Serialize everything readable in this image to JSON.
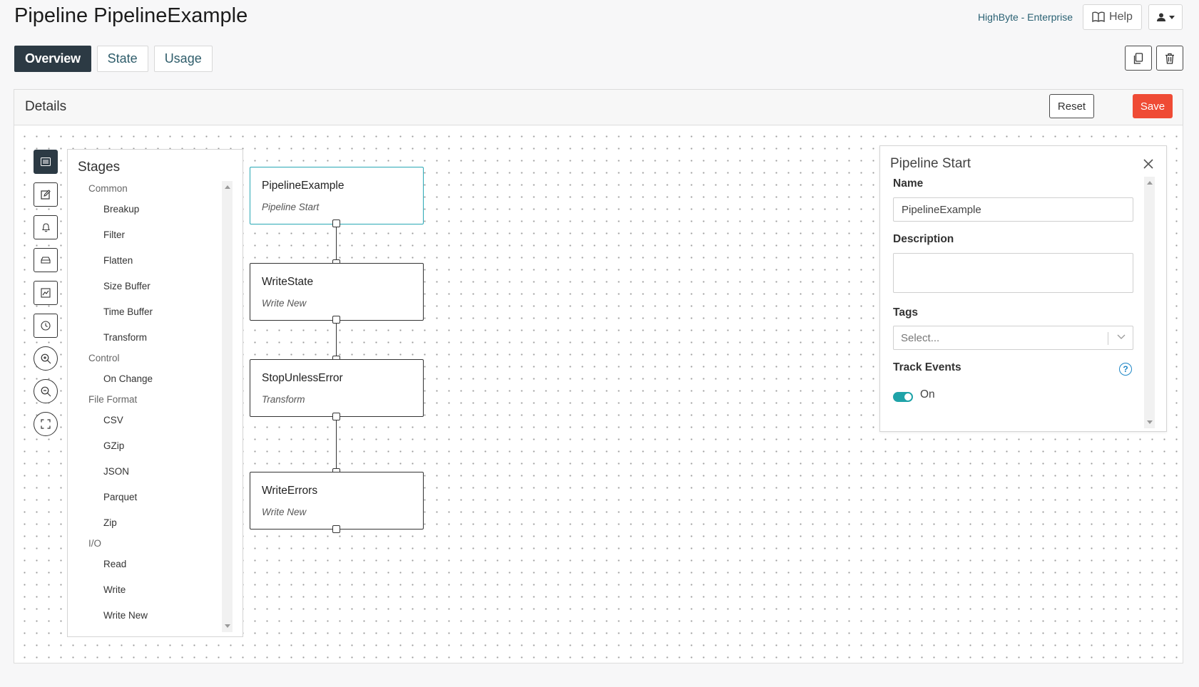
{
  "header": {
    "title": "Pipeline PipelineExample",
    "brand": "HighByte - Enterprise",
    "help_label": "Help"
  },
  "tabs": [
    {
      "label": "Overview",
      "active": true
    },
    {
      "label": "State",
      "active": false
    },
    {
      "label": "Usage",
      "active": false
    }
  ],
  "details": {
    "title": "Details",
    "reset_label": "Reset",
    "save_label": "Save"
  },
  "toolbar": {
    "icons": [
      "list-icon",
      "edit-icon",
      "bell-icon",
      "storage-icon",
      "chart-icon",
      "clock-icon",
      "zoom-in-icon",
      "zoom-out-icon",
      "fit-screen-icon"
    ]
  },
  "stages": {
    "title": "Stages",
    "categories": [
      {
        "name": "Common",
        "items": [
          "Breakup",
          "Filter",
          "Flatten",
          "Size Buffer",
          "Time Buffer",
          "Transform"
        ]
      },
      {
        "name": "Control",
        "items": [
          "On Change"
        ]
      },
      {
        "name": "File Format",
        "items": [
          "CSV",
          "GZip",
          "JSON",
          "Parquet",
          "Zip"
        ]
      },
      {
        "name": "I/O",
        "items": [
          "Read",
          "Write",
          "Write New"
        ]
      }
    ]
  },
  "nodes": [
    {
      "name": "PipelineExample",
      "type": "Pipeline Start",
      "selected": true
    },
    {
      "name": "WriteState",
      "type": "Write New",
      "selected": false
    },
    {
      "name": "StopUnlessError",
      "type": "Transform",
      "selected": false
    },
    {
      "name": "WriteErrors",
      "type": "Write New",
      "selected": false
    }
  ],
  "properties": {
    "title": "Pipeline Start",
    "name_label": "Name",
    "name_value": "PipelineExample",
    "description_label": "Description",
    "description_value": "",
    "tags_label": "Tags",
    "tags_placeholder": "Select...",
    "track_events_label": "Track Events",
    "track_events_value": "On",
    "track_events_on": true
  },
  "colors": {
    "primary_dark": "#2c3a44",
    "save": "#ef4b35",
    "accent_teal": "#1fa3a8",
    "selected_border": "#29a8b5",
    "help_blue": "#1e86c6"
  }
}
